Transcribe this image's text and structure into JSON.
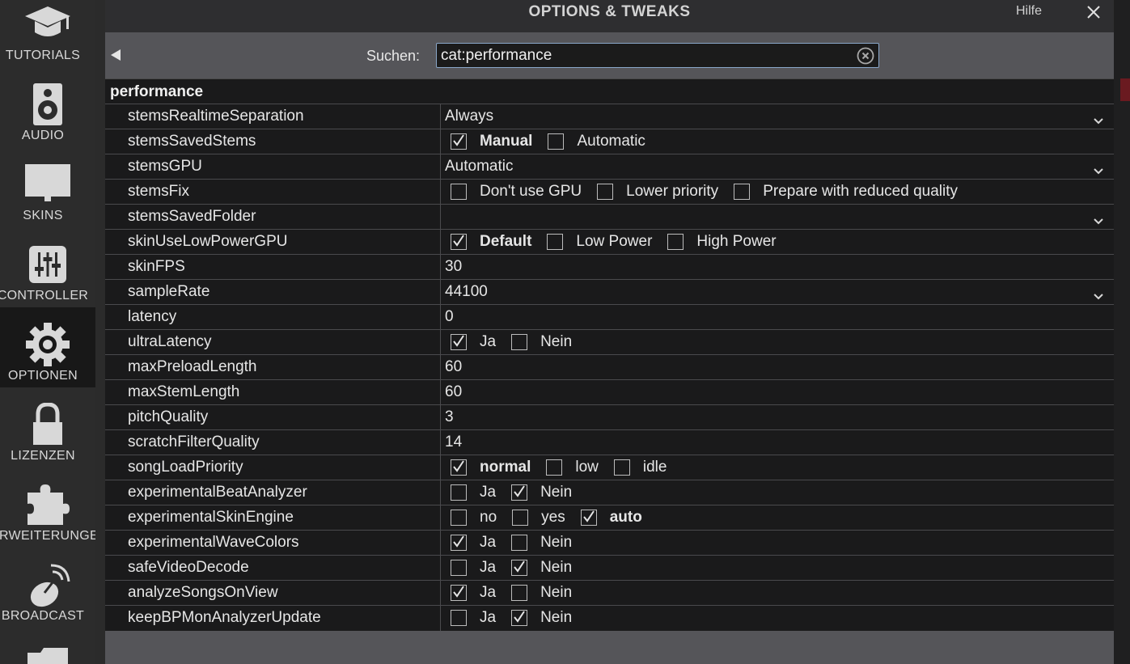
{
  "sidebar": {
    "items": [
      {
        "label": "TUTORIALS",
        "icon": "graduation-cap-icon"
      },
      {
        "label": "AUDIO",
        "icon": "speaker-icon"
      },
      {
        "label": "SKINS",
        "icon": "monitor-icon"
      },
      {
        "label": "CONTROLLER",
        "icon": "mixer-sliders-icon"
      },
      {
        "label": "OPTIONEN",
        "icon": "gear-icon"
      },
      {
        "label": "LIZENZEN",
        "icon": "lock-icon"
      },
      {
        "label": "ERWEITERUNGEN",
        "icon": "puzzle-icon"
      },
      {
        "label": "BROADCAST",
        "icon": "satellite-dish-icon"
      }
    ],
    "active": "OPTIONEN"
  },
  "dialog": {
    "title": "OPTIONS & TWEAKS",
    "help_label": "Hilfe",
    "search_label": "Suchen:",
    "search_value": "cat:performance",
    "category": "performance"
  },
  "settings": [
    {
      "name": "stemsRealtimeSeparation",
      "type": "dropdown",
      "value": "Always"
    },
    {
      "name": "stemsSavedStems",
      "type": "options",
      "options": [
        {
          "label": "Manual",
          "checked": true
        },
        {
          "label": "Automatic",
          "checked": false
        }
      ]
    },
    {
      "name": "stemsGPU",
      "type": "dropdown",
      "value": "Automatic"
    },
    {
      "name": "stemsFix",
      "type": "options",
      "options": [
        {
          "label": "Don't use GPU",
          "checked": false
        },
        {
          "label": "Lower priority",
          "checked": false
        },
        {
          "label": "Prepare with reduced quality",
          "checked": false
        }
      ]
    },
    {
      "name": "stemsSavedFolder",
      "type": "dropdown",
      "value": ""
    },
    {
      "name": "skinUseLowPowerGPU",
      "type": "options",
      "options": [
        {
          "label": "Default",
          "checked": true
        },
        {
          "label": "Low Power",
          "checked": false
        },
        {
          "label": "High Power",
          "checked": false
        }
      ]
    },
    {
      "name": "skinFPS",
      "type": "text",
      "value": "30"
    },
    {
      "name": "sampleRate",
      "type": "dropdown",
      "value": "44100"
    },
    {
      "name": "latency",
      "type": "text",
      "value": "0"
    },
    {
      "name": "ultraLatency",
      "type": "options",
      "options": [
        {
          "label": "Ja",
          "checked": true
        },
        {
          "label": "Nein",
          "checked": false
        }
      ]
    },
    {
      "name": "maxPreloadLength",
      "type": "text",
      "value": "60"
    },
    {
      "name": "maxStemLength",
      "type": "text",
      "value": "60"
    },
    {
      "name": "pitchQuality",
      "type": "text",
      "value": "3"
    },
    {
      "name": "scratchFilterQuality",
      "type": "text",
      "value": "14"
    },
    {
      "name": "songLoadPriority",
      "type": "options",
      "options": [
        {
          "label": "normal",
          "checked": true
        },
        {
          "label": "low",
          "checked": false
        },
        {
          "label": "idle",
          "checked": false
        }
      ]
    },
    {
      "name": "experimentalBeatAnalyzer",
      "type": "options",
      "options": [
        {
          "label": "Ja",
          "checked": false
        },
        {
          "label": "Nein",
          "checked": true
        }
      ]
    },
    {
      "name": "experimentalSkinEngine",
      "type": "options",
      "options": [
        {
          "label": "no",
          "checked": false
        },
        {
          "label": "yes",
          "checked": false
        },
        {
          "label": "auto",
          "checked": true
        }
      ]
    },
    {
      "name": "experimentalWaveColors",
      "type": "options",
      "options": [
        {
          "label": "Ja",
          "checked": true
        },
        {
          "label": "Nein",
          "checked": false
        }
      ]
    },
    {
      "name": "safeVideoDecode",
      "type": "options",
      "options": [
        {
          "label": "Ja",
          "checked": false
        },
        {
          "label": "Nein",
          "checked": true
        }
      ]
    },
    {
      "name": "analyzeSongsOnView",
      "type": "options",
      "options": [
        {
          "label": "Ja",
          "checked": true
        },
        {
          "label": "Nein",
          "checked": false
        }
      ]
    },
    {
      "name": "keepBPMonAnalyzerUpdate",
      "type": "options",
      "options": [
        {
          "label": "Ja",
          "checked": false
        },
        {
          "label": "Nein",
          "checked": true
        }
      ]
    }
  ]
}
